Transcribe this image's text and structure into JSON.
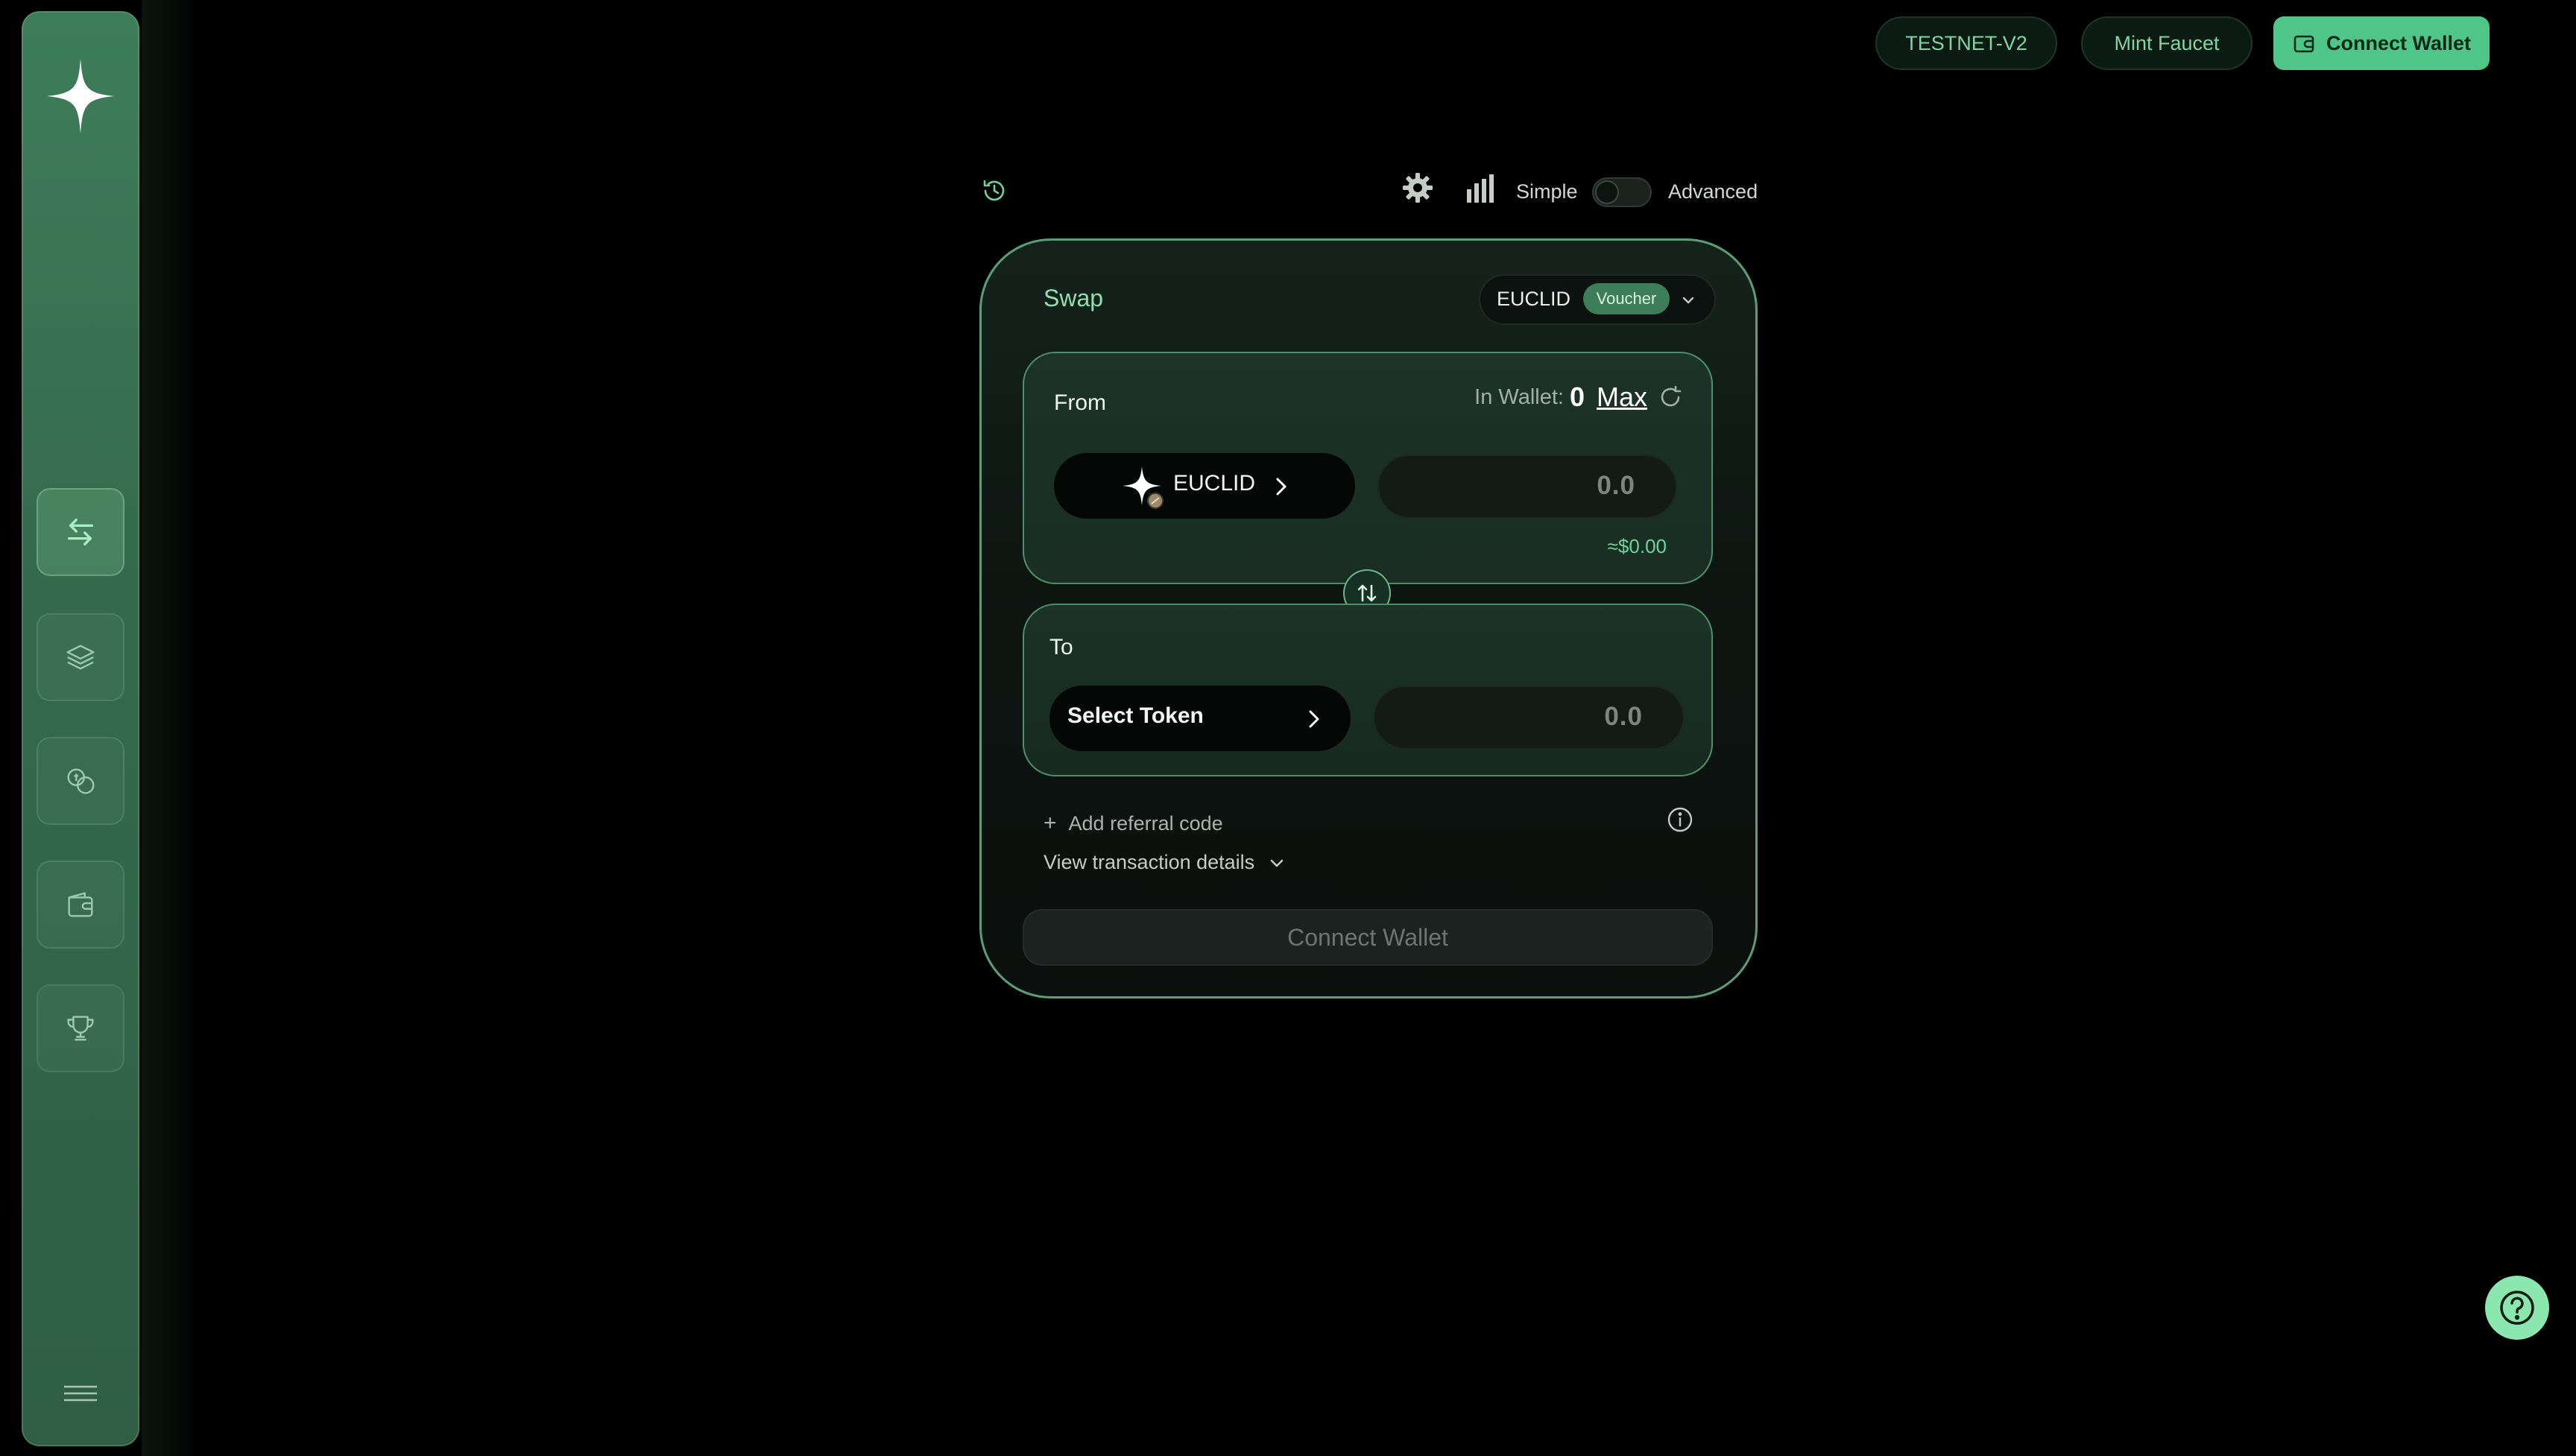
{
  "header": {
    "network_label": "TESTNET-V2",
    "faucet_label": "Mint Faucet",
    "connect_label": "Connect Wallet"
  },
  "sidebar": {
    "items": [
      {
        "icon": "swap-arrows-icon",
        "active": true
      },
      {
        "icon": "layers-icon",
        "active": false
      },
      {
        "icon": "coins-icon",
        "active": false
      },
      {
        "icon": "wallet-icon",
        "active": false
      },
      {
        "icon": "trophy-icon",
        "active": false
      }
    ]
  },
  "controls": {
    "mode_simple": "Simple",
    "mode_advanced": "Advanced"
  },
  "swap": {
    "title": "Swap",
    "chain": "EUCLID",
    "chain_badge": "Voucher",
    "from": {
      "label": "From",
      "wallet_label": "In Wallet:",
      "wallet_value": "0",
      "max_label": "Max",
      "token": "EUCLID",
      "amount_placeholder": "0.0",
      "usd_value": "≈$0.00"
    },
    "to": {
      "label": "To",
      "token": "Select Token",
      "amount_placeholder": "0.0"
    },
    "referral_label": "Add referral code",
    "details_label": "View transaction details",
    "connect_label": "Connect Wallet"
  },
  "colors": {
    "accent": "#4fc587",
    "accent_text": "#7fd6a0",
    "card_border": "#5a9e76",
    "sidebar": "#3e7d5a"
  }
}
